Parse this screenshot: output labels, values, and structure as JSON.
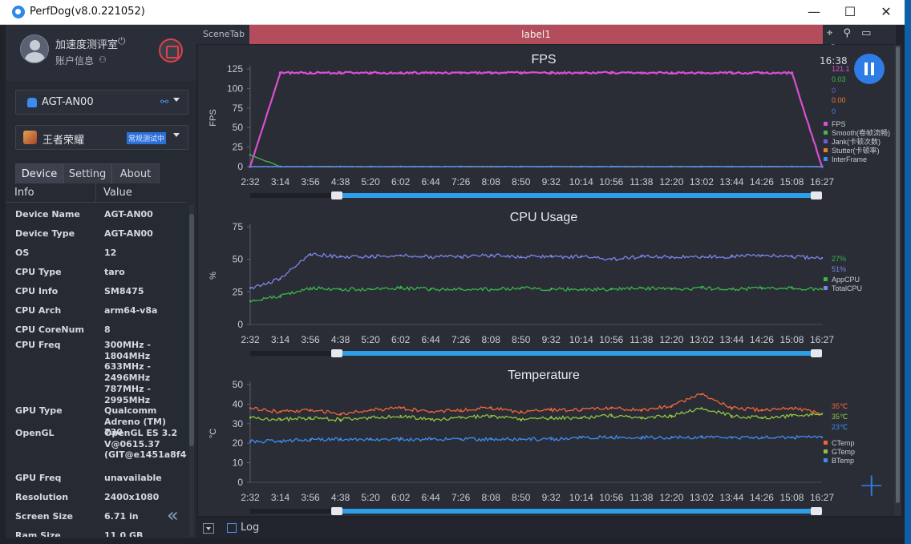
{
  "window": {
    "title": "PerfDog(v8.0.221052)",
    "minimize": "—",
    "maximize": "☐",
    "close": "✕"
  },
  "profile": {
    "user": "加速度测评室",
    "account": "账户信息",
    "power_icon": "⏻",
    "account_icon": "⚇"
  },
  "device_select": {
    "value": "AGT-AN00",
    "link_icon": "⚯"
  },
  "app_select": {
    "value": "王者荣耀",
    "mode": "常规测试中"
  },
  "tabs": [
    "Device",
    "Setting",
    "About"
  ],
  "table": {
    "headers": [
      "Info",
      "Value"
    ],
    "rows": [
      {
        "k": "Device Name",
        "v": "AGT-AN00"
      },
      {
        "k": "Device Type",
        "v": "AGT-AN00"
      },
      {
        "k": "OS",
        "v": "12"
      },
      {
        "k": "CPU Type",
        "v": "taro"
      },
      {
        "k": "CPU Info",
        "v": "SM8475"
      },
      {
        "k": "CPU Arch",
        "v": "arm64-v8a"
      },
      {
        "k": "CPU CoreNum",
        "v": "8"
      },
      {
        "k": "CPU Freq",
        "v": "300MHz - 1804MHz 633MHz - 2496MHz 787MHz - 2995MHz"
      },
      {
        "k": "GPU Type",
        "v": "Qualcomm Adreno (TM) 730"
      },
      {
        "k": "OpenGL",
        "v": "OpenGL ES 3.2 V@0615.37 (GIT@e1451a8f4d"
      },
      {
        "k": "GPU Freq",
        "v": "unavailable"
      },
      {
        "k": "Resolution",
        "v": "2400x1080"
      },
      {
        "k": "Screen Size",
        "v": "6.71 in"
      },
      {
        "k": "Ram Size",
        "v": "11.0 GB"
      }
    ],
    "collapse_icon": "«"
  },
  "scene": {
    "tab": "SceneTab",
    "label": "label1",
    "icons": [
      "⌖",
      "⚲",
      "▭",
      "☁"
    ]
  },
  "clock": "16:38",
  "bottom": {
    "log_label": "Log"
  },
  "add_icon": "+",
  "x_ticks": [
    "2:32",
    "3:14",
    "3:56",
    "4:38",
    "5:20",
    "6:02",
    "6:44",
    "7:26",
    "8:08",
    "8:50",
    "9:32",
    "10:14",
    "10:56",
    "11:38",
    "12:20",
    "13:02",
    "13:44",
    "14:26",
    "15:08",
    "16:27"
  ],
  "colors": {
    "fps": "#d94fd0",
    "smooth": "#3fb950",
    "jank": "#6a5de0",
    "stutter": "#ef7b2f",
    "interframe": "#3b8ef0",
    "cpu_app": "#39b54a",
    "cpu_total": "#7b86e8",
    "ctemp": "#f0663a",
    "gtemp": "#8cc63f",
    "btemp": "#3b8ef0",
    "slider": "#2e9ee8"
  },
  "chart_data": [
    {
      "type": "line",
      "title": "FPS",
      "ylabel": "FPS",
      "ylim": [
        0,
        125
      ],
      "yticks": [
        0,
        25,
        50,
        75,
        100,
        125
      ],
      "x_start": "2:32",
      "x_end": "16:27",
      "series": [
        {
          "name": "FPS",
          "current": "121.1",
          "color": "#d94fd0",
          "values": [
            0,
            120,
            120,
            120,
            120,
            120,
            120,
            120,
            120,
            120,
            120,
            120,
            120,
            120,
            120,
            120,
            120,
            120,
            120,
            0
          ]
        },
        {
          "name": "Smooth(卷帧流畅)",
          "current": "0.03",
          "color": "#3fb950",
          "values": [
            15,
            0,
            0,
            0,
            0,
            0,
            0,
            0,
            0,
            0,
            0,
            0,
            0,
            0,
            0,
            0,
            0,
            0,
            0,
            0
          ]
        },
        {
          "name": "Jank(卡顿次数)",
          "current": "0",
          "color": "#6a5de0",
          "values": [
            0,
            0,
            0,
            0,
            0,
            0,
            0,
            0,
            0,
            0,
            0,
            0,
            0,
            0,
            0,
            0,
            0,
            0,
            0,
            0
          ]
        },
        {
          "name": "Stutter(卡顿率)",
          "current": "0.00",
          "color": "#ef7b2f",
          "values": [
            0,
            0,
            0,
            0,
            0,
            0,
            0,
            0,
            0,
            0,
            0,
            0,
            0,
            0,
            0,
            0,
            0,
            0,
            0,
            0
          ]
        },
        {
          "name": "InterFrame",
          "current": "0",
          "color": "#3b8ef0",
          "values": [
            0,
            0,
            0,
            0,
            0,
            0,
            0,
            0,
            0,
            0,
            0,
            0,
            0,
            0,
            0,
            0,
            0,
            0,
            0,
            0
          ]
        }
      ]
    },
    {
      "type": "line",
      "title": "CPU Usage",
      "ylabel": "%",
      "ylim": [
        0,
        75
      ],
      "yticks": [
        0,
        25,
        50,
        75
      ],
      "x_start": "2:32",
      "x_end": "16:27",
      "series": [
        {
          "name": "AppCPU",
          "current": "27%",
          "color": "#39b54a",
          "values": [
            18,
            22,
            28,
            27,
            27,
            28,
            27,
            27,
            27,
            28,
            27,
            27,
            27,
            28,
            27,
            28,
            27,
            28,
            28,
            27
          ]
        },
        {
          "name": "TotalCPU",
          "current": "51%",
          "color": "#7b86e8",
          "values": [
            28,
            35,
            54,
            52,
            52,
            53,
            52,
            52,
            53,
            52,
            52,
            52,
            50,
            52,
            52,
            52,
            52,
            53,
            52,
            51
          ]
        }
      ]
    },
    {
      "type": "line",
      "title": "Temperature",
      "ylabel": "°C",
      "ylim": [
        0,
        50
      ],
      "yticks": [
        0,
        10,
        20,
        30,
        40,
        50
      ],
      "x_start": "2:32",
      "x_end": "16:27",
      "series": [
        {
          "name": "CTemp",
          "current": "35℃",
          "color": "#f0663a",
          "values": [
            38,
            36,
            37,
            35,
            37,
            38,
            36,
            37,
            38,
            36,
            37,
            37,
            38,
            37,
            39,
            45,
            38,
            37,
            38,
            35
          ]
        },
        {
          "name": "GTemp",
          "current": "35℃",
          "color": "#8cc63f",
          "values": [
            33,
            32,
            33,
            32,
            33,
            34,
            32,
            33,
            34,
            32,
            33,
            33,
            34,
            33,
            34,
            38,
            34,
            33,
            34,
            35
          ]
        },
        {
          "name": "BTemp",
          "current": "23℃",
          "color": "#3b8ef0",
          "values": [
            21,
            21,
            22,
            22,
            22,
            22,
            22,
            22,
            22,
            22,
            22,
            23,
            23,
            23,
            23,
            23,
            23,
            23,
            23,
            23
          ]
        }
      ]
    }
  ]
}
